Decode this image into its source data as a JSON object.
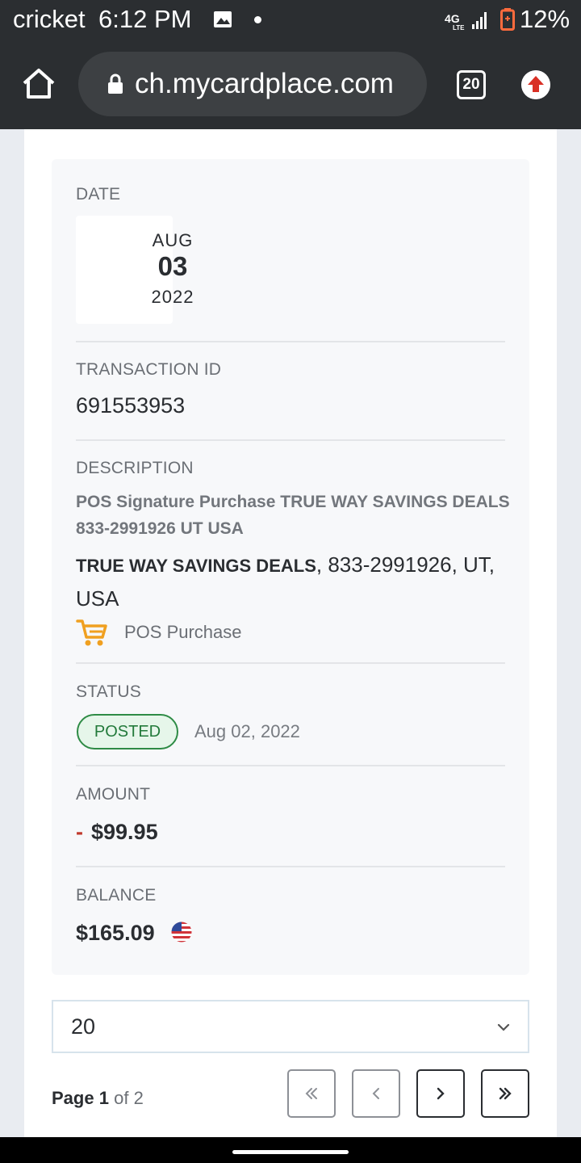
{
  "status_bar": {
    "carrier": "cricket",
    "time": "6:12 PM",
    "battery": "12%"
  },
  "browser": {
    "url": "сh.mycardplace.com",
    "tab_count": "20"
  },
  "transaction": {
    "date_label": "DATE",
    "date_month": "AUG",
    "date_day": "03",
    "date_year": "2022",
    "id_label": "TRANSACTION ID",
    "id_value": "691553953",
    "description_label": "DESCRIPTION",
    "description_raw": "POS Signature Purchase TRUE WAY SAVINGS DEALS 833-2991926 UT USA",
    "merchant_name": "TRUE WAY SAVINGS DEALS",
    "merchant_details": ", 833-2991926, UT, USA",
    "category": "POS Purchase",
    "status_label": "STATUS",
    "status_value": "POSTED",
    "status_date": "Aug 02, 2022",
    "amount_label": "AMOUNT",
    "amount_sign": "-",
    "amount_value": "$99.95",
    "balance_label": "BALANCE",
    "balance_value": "$165.09"
  },
  "pagination": {
    "page_size": "20",
    "page_word": "Page",
    "current_page": "1",
    "of_word": "of",
    "total_pages": "2"
  },
  "colors": {
    "accent_cart": "#f0a020",
    "status_green": "#2e8b45",
    "negative_red": "#c0392b"
  }
}
